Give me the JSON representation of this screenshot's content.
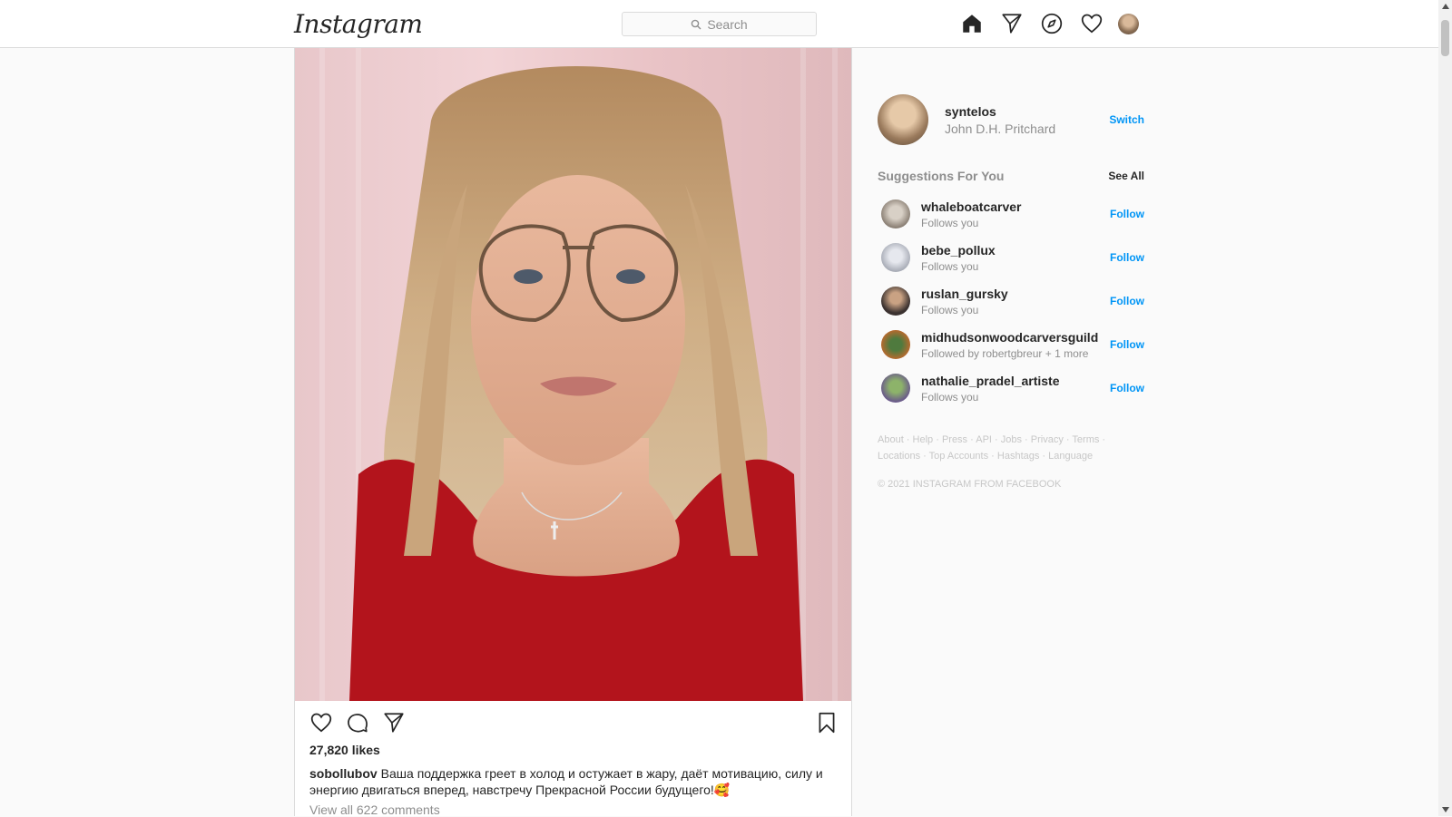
{
  "header": {
    "logo": "Instagram",
    "search_placeholder": "Search",
    "icons": [
      "home-icon",
      "direct-message-icon",
      "explore-compass-icon",
      "activity-heart-icon",
      "profile-avatar"
    ]
  },
  "post": {
    "photo_icon": "portrait-photo",
    "actions": [
      "like-heart-icon",
      "comment-icon",
      "share-icon"
    ],
    "save_icon": "bookmark-icon",
    "likes": "27,820 likes",
    "caption_user": "sobollubov",
    "caption_text": "Ваша поддержка греет в холод и остужает в жару, даёт мотивацию, силу и энергию двигаться вперед, навстречу Прекрасной России будущего!🥰",
    "view_comments": "View all 622 comments"
  },
  "sidebar": {
    "username": "syntelos",
    "full_name": "John D.H. Pritchard",
    "switch_label": "Switch",
    "suggestions_title": "Suggestions For You",
    "see_all": "See All",
    "suggestions": [
      {
        "username": "whaleboatcarver",
        "subtitle": "Follows you",
        "action": "Follow",
        "avatar_color": "#8a7f74"
      },
      {
        "username": "bebe_pollux",
        "subtitle": "Follows you",
        "action": "Follow",
        "avatar_color": "#a9adb7"
      },
      {
        "username": "ruslan_gursky",
        "subtitle": "Follows you",
        "action": "Follow",
        "avatar_color": "#3b3230"
      },
      {
        "username": "midhudsonwoodcarversguild",
        "subtitle": "Followed by robertgbreur + 1 more",
        "action": "Follow",
        "avatar_color": "#b56a2e"
      },
      {
        "username": "nathalie_pradel_artiste",
        "subtitle": "Follows you",
        "action": "Follow",
        "avatar_color": "#6a5a8a"
      }
    ],
    "footer_links": [
      "About",
      "Help",
      "Press",
      "API",
      "Jobs",
      "Privacy",
      "Terms",
      "Locations",
      "Top Accounts",
      "Hashtags",
      "Language"
    ],
    "copyright": "© 2021 INSTAGRAM FROM FACEBOOK"
  },
  "colors": {
    "accent": "#0095f6",
    "border": "#dbdbdb",
    "muted": "#8e8e8e",
    "background": "#fafafa"
  }
}
